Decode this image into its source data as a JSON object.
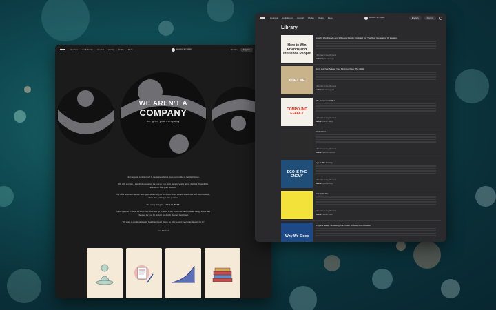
{
  "left_window": {
    "nav": {
      "logo": "brand-logo-icon",
      "items": [
        "Courses",
        "Audiobooks",
        "Journal",
        "Library",
        "Guide",
        "More"
      ],
      "brand_label": "WE AREN'T A COMPANY",
      "donate_label": "Donate",
      "language_label": "English",
      "signin_label": "Sign In"
    },
    "hero": {
      "line1": "WE AREN'T A",
      "line2": "COMPANY",
      "tagline": "we give you company"
    },
    "paragraphs": [
      "Do you want to improve? If the answer is yes, you have come to the right place.",
      "We will provide a bunch of resources for you so you don't have to worry about digging through the internet to find your answers.",
      "We offer lessons, courses, and applications so you can learn about mental health and self improvement, while also putting it into practice.",
      "The crazy thing is... IT'S ALL FREE!",
      "Subscriptions to these services can often add up to $200 USD, so we decided to make things easier and cheaper for you (it doesn't get much cheaper than free).",
      "We want to promote mental health and well living, so why would we charge money for it?"
    ],
    "section_label": "Get Started",
    "cards": [
      "meditation-illustration",
      "journal-illustration",
      "growth-chart-illustration",
      "book-stack-illustration"
    ]
  },
  "right_window": {
    "nav": {
      "items": [
        "Courses",
        "Audiobooks",
        "Journal",
        "Library",
        "Guide",
        "More"
      ],
      "brand_label": "WE AREN'T A COMPANY",
      "language_label": "English",
      "signin_label": "Sign In"
    },
    "title": "Library",
    "link_prefix": "Click here to buy the book",
    "author_prefix": "Author:",
    "books": [
      {
        "title": "How To Win Friends And Influence People: Updated For The Next Generation Of Leaders",
        "author": "Dale Carnegie",
        "cover_text": "How to Win Friends and Influence People",
        "cover_bg": "#f4f1ea",
        "cover_fg": "#222222"
      },
      {
        "title": "Don't Hurt Me: Master Your Mind And Defy The Odds",
        "author": "David Goggins",
        "cover_text": "HURT ME",
        "cover_bg": "#c9b38a",
        "cover_fg": "#ffffff"
      },
      {
        "title": "The Compound Effect",
        "author": "Darren Hardy",
        "cover_text": "COMPOUND EFFECT",
        "cover_bg": "#f4f1ea",
        "cover_fg": "#d4331f"
      },
      {
        "title": "Meditations",
        "author": "Marcus Aurelius",
        "cover_text": "",
        "cover_bg": "#2b2b2b",
        "cover_fg": "#ffffff"
      },
      {
        "title": "Ego Is The Enemy",
        "author": "Ryan Holiday",
        "cover_text": "EGO IS THE ENEMY",
        "cover_bg": "#1f4e78",
        "cover_fg": "#ffffff"
      },
      {
        "title": "Atomic Habits",
        "author": "James Clear",
        "cover_text": "",
        "cover_bg": "#f3e23a",
        "cover_fg": "#222222"
      },
      {
        "title": "Why We Sleep: Unlocking The Power Of Sleep And Dreams",
        "author": "Matthew Walker",
        "cover_text": "Why We Sleep",
        "cover_bg": "#1d4a86",
        "cover_fg": "#ffffff"
      }
    ]
  }
}
